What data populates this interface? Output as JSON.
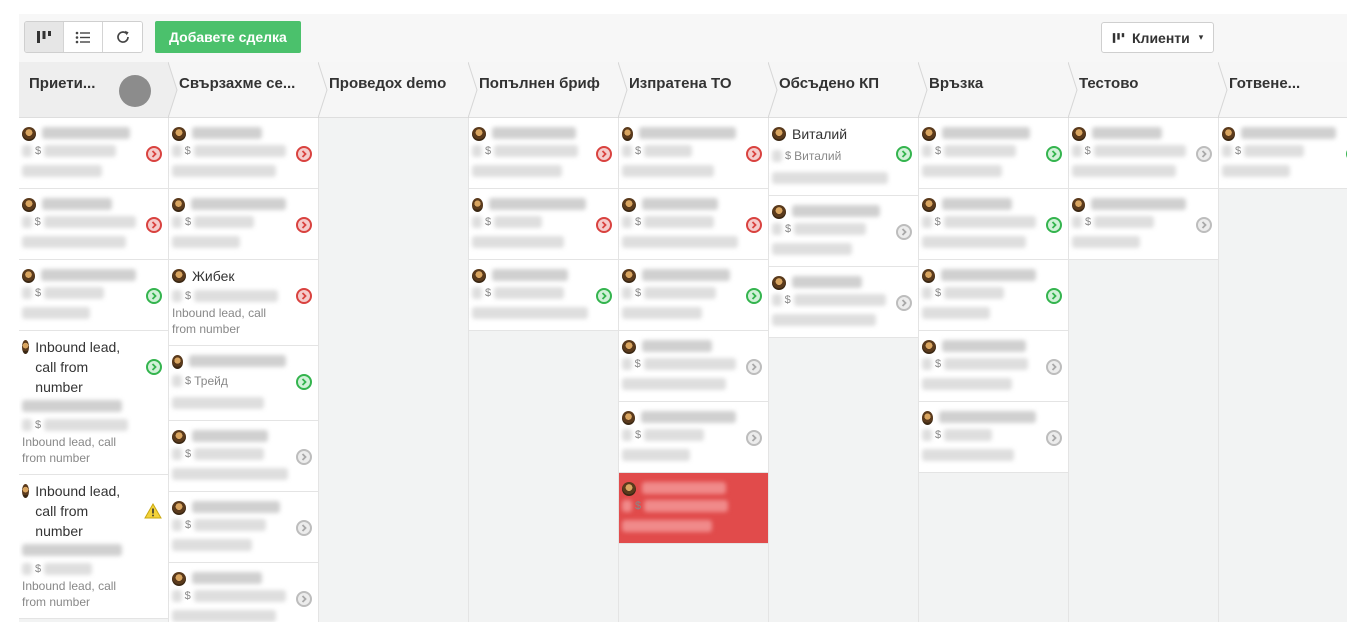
{
  "toolbar": {
    "add_deal_label": "Добавете сделка",
    "clients_label": "Клиенти",
    "caret": "▾",
    "view_buttons": [
      "kanban-view-icon",
      "list-view-icon",
      "refresh-icon"
    ]
  },
  "colors": {
    "accent_green": "#4bc16c",
    "status_red": "#d9423f",
    "status_green": "#34b44e",
    "status_grey": "#bdbdbd",
    "highlight_card": "#e14b4b"
  },
  "columns": [
    {
      "name": "Приети...",
      "cards": [
        {
          "status": "red"
        },
        {
          "status": "red"
        },
        {
          "status": "green"
        },
        {
          "name": "Inbound lead, call from number",
          "sub": "Inbound lead, call from number",
          "status": "green"
        },
        {
          "name": "Inbound lead, call from number",
          "sub": "Inbound lead, call from number",
          "status": "warning"
        }
      ]
    },
    {
      "name": "Свързахме се...",
      "cards": [
        {
          "status": "red"
        },
        {
          "status": "red"
        },
        {
          "name": "Жибек",
          "sub": "Inbound lead, call from number",
          "status": "red"
        },
        {
          "sub": "Трейд",
          "status": "green"
        },
        {
          "status": "grey"
        },
        {
          "status": "grey"
        },
        {
          "status": "grey"
        }
      ]
    },
    {
      "name": "Проведох demo",
      "cards": []
    },
    {
      "name": "Попълнен бриф",
      "cards": [
        {
          "status": "red"
        },
        {
          "status": "red"
        },
        {
          "status": "green"
        }
      ]
    },
    {
      "name": "Изпратена ТО",
      "cards": [
        {
          "status": "red"
        },
        {
          "status": "red"
        },
        {
          "status": "green"
        },
        {
          "status": "grey"
        },
        {
          "status": "grey"
        },
        {
          "status": "none",
          "highlight": true
        }
      ]
    },
    {
      "name": "Обсъдено КП",
      "cards": [
        {
          "name": "Виталий",
          "sub": "Виталий",
          "status": "green"
        },
        {
          "status": "grey"
        },
        {
          "status": "grey"
        }
      ]
    },
    {
      "name": "Връзка",
      "cards": [
        {
          "status": "green"
        },
        {
          "status": "green"
        },
        {
          "status": "green"
        },
        {
          "status": "grey"
        },
        {
          "status": "grey"
        }
      ]
    },
    {
      "name": "Тестово",
      "cards": [
        {
          "status": "grey"
        },
        {
          "status": "grey"
        }
      ]
    },
    {
      "name": "Готвене...",
      "cards": [
        {
          "status": "green"
        }
      ]
    }
  ]
}
